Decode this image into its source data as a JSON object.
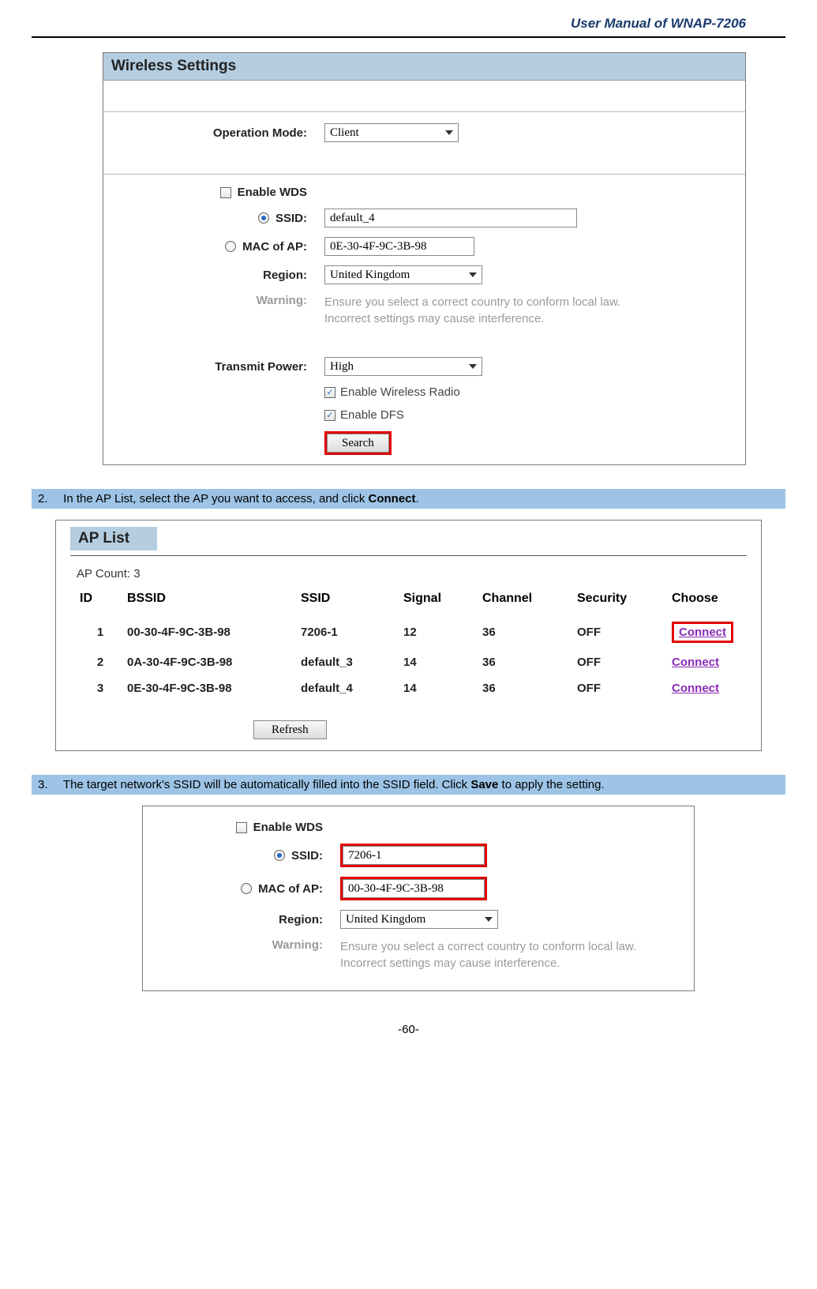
{
  "document_header": "User Manual of WNAP-7206",
  "page_number": "-60-",
  "wireless_settings_panel": {
    "title": "Wireless Settings",
    "operation_mode": {
      "label": "Operation Mode:",
      "value": "Client"
    },
    "enable_wds": {
      "label": "Enable WDS",
      "checked": false
    },
    "ssid": {
      "label": "SSID:",
      "value": "default_4",
      "radio_selected": true
    },
    "mac_of_ap": {
      "label": "MAC of AP:",
      "value": "0E-30-4F-9C-3B-98",
      "radio_selected": false
    },
    "region": {
      "label": "Region:",
      "value": "United Kingdom"
    },
    "warning": {
      "label": "Warning:",
      "text_line1": "Ensure you select a correct country to conform local law.",
      "text_line2": "Incorrect settings may cause interference."
    },
    "transmit_power": {
      "label": "Transmit Power:",
      "value": "High"
    },
    "enable_wireless_radio": {
      "label": "Enable Wireless Radio",
      "checked": true
    },
    "enable_dfs": {
      "label": "Enable DFS",
      "checked": true
    },
    "search_button": "Search"
  },
  "step2": {
    "number": "2.",
    "text_before": "In the AP List, select the AP you want to access, and click ",
    "text_bold": "Connect",
    "text_after": "."
  },
  "ap_list_panel": {
    "title": "AP List",
    "ap_count_label": "AP Count: 3",
    "headers": {
      "id": "ID",
      "bssid": "BSSID",
      "ssid": "SSID",
      "signal": "Signal",
      "channel": "Channel",
      "security": "Security",
      "choose": "Choose"
    },
    "rows": [
      {
        "id": "1",
        "bssid": "00-30-4F-9C-3B-98",
        "ssid": "7206-1",
        "signal": "12",
        "channel": "36",
        "security": "OFF",
        "choose": "Connect",
        "highlighted": true
      },
      {
        "id": "2",
        "bssid": "0A-30-4F-9C-3B-98",
        "ssid": "default_3",
        "signal": "14",
        "channel": "36",
        "security": "OFF",
        "choose": "Connect",
        "highlighted": false
      },
      {
        "id": "3",
        "bssid": "0E-30-4F-9C-3B-98",
        "ssid": "default_4",
        "signal": "14",
        "channel": "36",
        "security": "OFF",
        "choose": "Connect",
        "highlighted": false
      }
    ],
    "refresh_button": "Refresh"
  },
  "step3": {
    "number": "3.",
    "text_before": "The target network's SSID will be automatically filled into the SSID field. Click ",
    "text_bold": "Save",
    "text_after": " to apply the setting."
  },
  "filled_panel": {
    "enable_wds": {
      "label": "Enable WDS",
      "checked": false
    },
    "ssid": {
      "label": "SSID:",
      "value": "7206-1",
      "radio_selected": true
    },
    "mac_of_ap": {
      "label": "MAC of AP:",
      "value": "00-30-4F-9C-3B-98",
      "radio_selected": false
    },
    "region": {
      "label": "Region:",
      "value": "United Kingdom"
    },
    "warning": {
      "label": "Warning:",
      "text_line1": "Ensure you select a correct country to conform local law.",
      "text_line2": "Incorrect settings may cause interference."
    }
  }
}
